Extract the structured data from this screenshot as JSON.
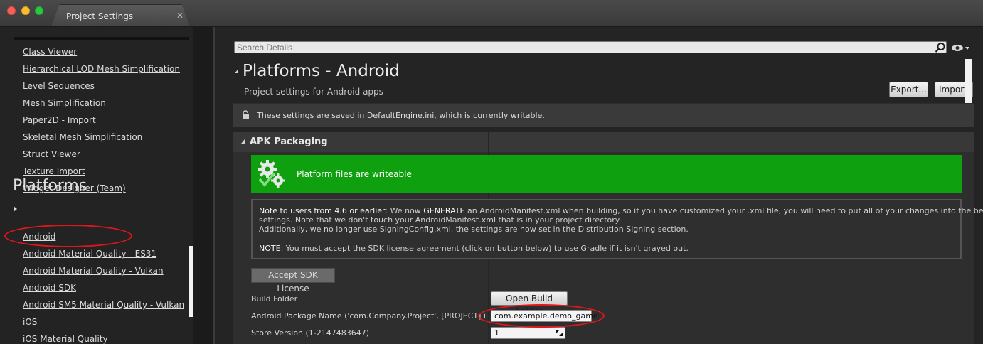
{
  "window": {
    "tab_title": "Project Settings",
    "tab_close": "✕"
  },
  "sidebar": {
    "items_top": [
      "Class Viewer",
      "Hierarchical LOD Mesh Simplification",
      "Level Sequences",
      "Mesh Simplification",
      "Paper2D - Import",
      "Skeletal Mesh Simplification",
      "Struct Viewer",
      "Texture Import",
      "Widget Designer (Team)"
    ],
    "category": "Platforms",
    "items_platforms": [
      "Android",
      "Android Material Quality - ES31",
      "Android Material Quality - Vulkan",
      "Android SDK",
      "Android SM5 Material Quality - Vulkan",
      "iOS",
      "iOS Material Quality"
    ],
    "selected": "Android"
  },
  "search": {
    "placeholder": "Search Details"
  },
  "header": {
    "title": "Platforms - Android",
    "subtitle": "Project settings for Android apps",
    "export_label": "Export...",
    "import_label": "Import..."
  },
  "info_bar": {
    "text": "These settings are saved in DefaultEngine.ini, which is currently writable."
  },
  "section": {
    "title": "APK Packaging",
    "banner_text": "Platform files are writeable",
    "banner_color": "#0ea00e",
    "note": {
      "line1_bold": "Note to users from 4.6 or earlier",
      "line1_rest": ": We now ",
      "line1_bold2": "GENERATE",
      "line1_tail": " an AndroidManifest.xml when building, so if you have customized your .xml file, you will need to put all of your changes into the below",
      "line2": "settings. Note that we don't touch your AndroidManifest.xml that is in your project directory.",
      "line3": "Additionally, we no longer use SigningConfig.xml, the settings are now set in the Distribution Signing section.",
      "line4_bold": "NOTE",
      "line4_rest": ": You must accept the SDK license agreement (click on button below) to use Gradle if it isn't grayed out."
    },
    "accept_sdk_label": "Accept SDK License",
    "properties": {
      "build_folder_label": "Build Folder",
      "build_folder_button": "Open Build Folder",
      "package_name_label": "Android Package Name ('com.Company.Project', [PROJECT] is replaced with project name)",
      "package_name_value": "com.example.demo_game",
      "store_version_label": "Store Version (1-2147483647)",
      "store_version_value": "1"
    }
  },
  "annotation_color": "#e0161a"
}
